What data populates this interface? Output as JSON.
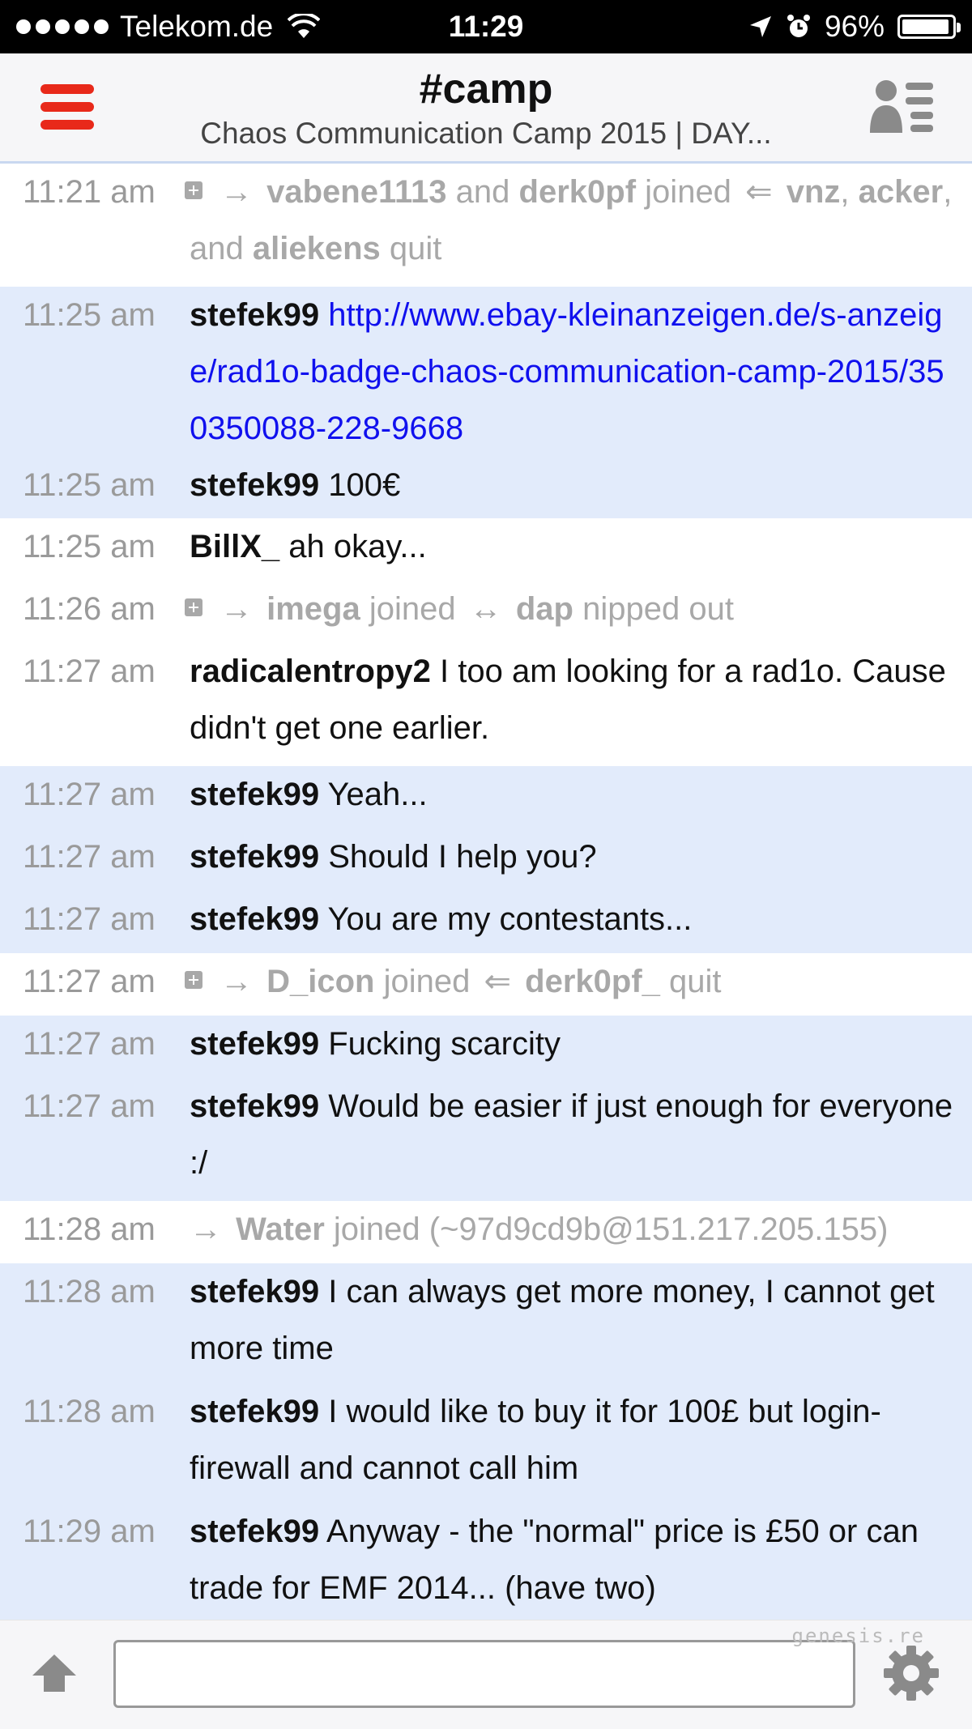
{
  "status_bar": {
    "carrier": "Telekom.de",
    "time": "11:29",
    "battery": "96%",
    "battery_level": 0.96
  },
  "header": {
    "channel": "#camp",
    "topic": "Chaos Communication Camp 2015 | DAY..."
  },
  "messages": [
    {
      "time": "11:21 am",
      "system": true
    },
    {
      "time": "11:25 am",
      "nick": "stefek99",
      "link": "http://www.ebay-kleinanzeigen.de/s-anzeige/rad1o-badge-chaos-communication-camp-2015/350350088-228-9668"
    },
    {
      "time": "11:25 am",
      "nick": "stefek99",
      "text": "100€"
    },
    {
      "time": "11:25 am",
      "nick": "BillX_",
      "text": "ah okay..."
    },
    {
      "time": "11:26 am",
      "system": true
    },
    {
      "time": "11:27 am",
      "nick": "radicalentropy2",
      "text": "I too am looking for a rad1o. Cause didn't get one earlier."
    },
    {
      "time": "11:27 am",
      "nick": "stefek99",
      "text": "Yeah..."
    },
    {
      "time": "11:27 am",
      "nick": "stefek99",
      "text": "Should I help you?"
    },
    {
      "time": "11:27 am",
      "nick": "stefek99",
      "text": "You are my contestants..."
    },
    {
      "time": "11:27 am",
      "system": true
    },
    {
      "time": "11:27 am",
      "nick": "stefek99",
      "text": "Fucking scarcity"
    },
    {
      "time": "11:27 am",
      "nick": "stefek99",
      "text": "Would be easier if just enough for everyone :/"
    },
    {
      "time": "11:28 am",
      "system": true
    },
    {
      "time": "11:28 am",
      "nick": "stefek99",
      "text": "I can always get more money, I cannot get more time"
    },
    {
      "time": "11:28 am",
      "nick": "stefek99",
      "text": "I would like to buy it for 100£ but login-firewall and cannot call him"
    },
    {
      "time": "11:29 am",
      "nick": "stefek99",
      "text": "Anyway - the \"normal\" price is £50 or can trade for EMF 2014... (have two)"
    }
  ],
  "system_events": {
    "e1": {
      "nick1": "vabene1113",
      "and1": "and",
      "nick2": "derk0pf",
      "joined": "joined",
      "nick3": "vnz",
      "nick4": "acker",
      "and2": ", and",
      "nick5": "aliekens",
      "quit": "quit"
    },
    "e2": {
      "nick1": "imega",
      "joined": "joined",
      "nick2": "dap",
      "nipped": "nipped out"
    },
    "e3": {
      "nick1": "D_icon",
      "joined": "joined",
      "nick2": "derk0pf_",
      "quit": "quit"
    },
    "e4": {
      "nick1": "Water",
      "joined": "joined (~97d9cd9b@151.217.205.155)"
    }
  },
  "footer": {
    "input_value": "",
    "input_placeholder": ""
  },
  "watermark": "genesis.re",
  "colors": {
    "accent_red": "#e8291a",
    "highlight_row": "#e2ebfb",
    "link": "#1010ee",
    "system_text": "#a8a8a8"
  }
}
